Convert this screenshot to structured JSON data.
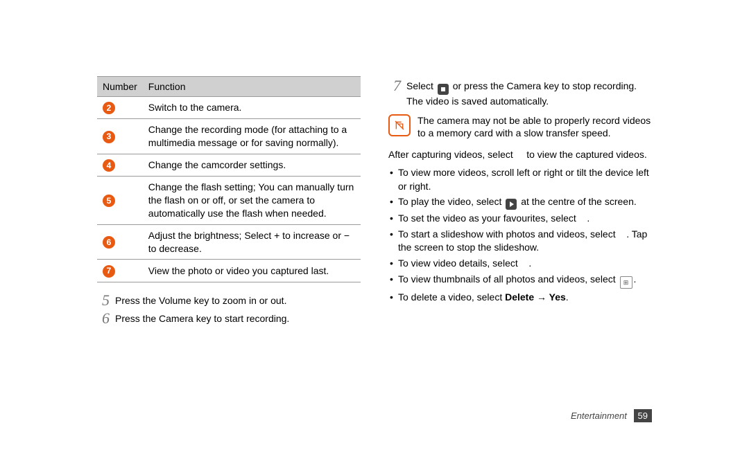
{
  "table": {
    "header_number": "Number",
    "header_function": "Function",
    "rows": [
      {
        "num": "2",
        "func": "Switch to the camera."
      },
      {
        "num": "3",
        "func": "Change the recording mode (for attaching to a multimedia message or for saving normally)."
      },
      {
        "num": "4",
        "func": "Change the camcorder settings."
      },
      {
        "num": "5",
        "func": "Change the flash setting; You can manually turn the flash on or off, or set the camera to automatically use the flash when needed."
      },
      {
        "num": "6",
        "func": "Adjust the brightness; Select + to increase or − to decrease."
      },
      {
        "num": "7",
        "func": "View the photo or video you captured last."
      }
    ]
  },
  "steps_left": [
    {
      "n": "5",
      "t": "Press the Volume key to zoom in or out."
    },
    {
      "n": "6",
      "t": "Press the Camera key to start recording."
    }
  ],
  "step7": {
    "n": "7",
    "pre": "Select ",
    "mid": " or press the Camera key to stop recording.",
    "line2": "The video is saved automatically."
  },
  "note": "The camera may not be able to properly record videos to a memory card with a slow transfer speed.",
  "after": {
    "pre": "After capturing videos, select ",
    "post": " to view the captured videos."
  },
  "bullets": {
    "b1": "To view more videos, scroll left or right or tilt the device left or right.",
    "b2_pre": "To play the video, select ",
    "b2_post": " at the centre of the screen.",
    "b3": "To set the video as your favourites, select ",
    "b3_end": ".",
    "b4": "To start a slideshow with photos and videos, select ",
    "b4_mid": ". Tap the screen to stop the slideshow.",
    "b5": "To view video details, select ",
    "b5_end": ".",
    "b6_pre": "To view thumbnails of all photos and videos, select ",
    "b6_post": ".",
    "b7_pre": "To delete a video, select ",
    "b7_bold": "Delete → Yes",
    "b7_post": "."
  },
  "footer": {
    "section": "Entertainment",
    "page": "59"
  }
}
